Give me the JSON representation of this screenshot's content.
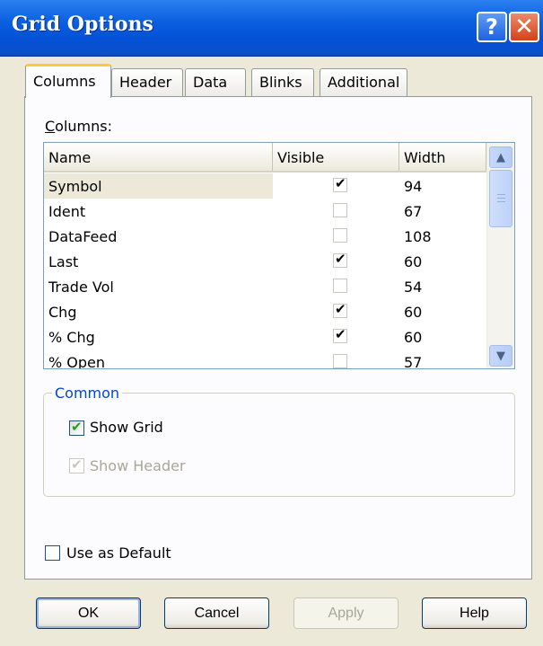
{
  "window": {
    "title": "Grid Options",
    "help_glyph": "?",
    "close_glyph": "✕"
  },
  "tabs": [
    {
      "label": "Columns",
      "active": true
    },
    {
      "label": "Header",
      "active": false
    },
    {
      "label": "Data",
      "active": false
    },
    {
      "label": "Blinks",
      "active": false
    },
    {
      "label": "Additional",
      "active": false
    }
  ],
  "columns_section": {
    "label_accel": "C",
    "label_rest": "olumns:",
    "headers": {
      "name": "Name",
      "visible": "Visible",
      "width": "Width"
    },
    "rows": [
      {
        "name": "Symbol",
        "visible": true,
        "width": "94",
        "selected": true
      },
      {
        "name": "Ident",
        "visible": false,
        "width": "67"
      },
      {
        "name": "DataFeed",
        "visible": false,
        "width": "108"
      },
      {
        "name": "Last",
        "visible": true,
        "width": "60"
      },
      {
        "name": "Trade Vol",
        "visible": false,
        "width": "54"
      },
      {
        "name": "Chg",
        "visible": true,
        "width": "60"
      },
      {
        "name": "% Chg",
        "visible": true,
        "width": "60"
      },
      {
        "name": "% Open",
        "visible": false,
        "width": "57"
      }
    ],
    "scroll_up_glyph": "▲",
    "scroll_down_glyph": "▼"
  },
  "common": {
    "legend": "Common",
    "show_grid": {
      "label": "Show Grid",
      "checked": true,
      "enabled": true
    },
    "show_header": {
      "label": "Show Header",
      "checked": true,
      "enabled": false
    }
  },
  "use_as_default": {
    "label": "Use as Default",
    "checked": false
  },
  "check_glyph": "✔",
  "buttons": {
    "ok": "OK",
    "cancel": "Cancel",
    "apply": "Apply",
    "help": "Help"
  },
  "colors": {
    "titlebar": "#0a5fe0",
    "legend_text": "#0046d5",
    "dialog_bg": "#ece9d8",
    "active_tab_highlight": "#ffc83c"
  }
}
